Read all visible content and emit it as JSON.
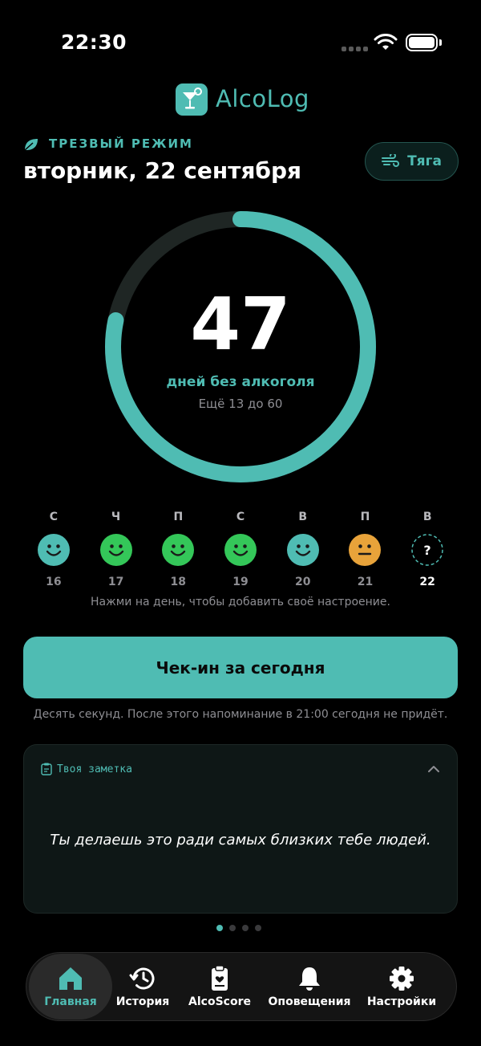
{
  "status": {
    "time": "22:30"
  },
  "app": {
    "name": "AlcoLog"
  },
  "header": {
    "mode_label": "ТРЕЗВЫЙ РЕЖИМ",
    "date": "вторник, 22 сентября",
    "craving_label": "Тяга"
  },
  "counter": {
    "days": "47",
    "days_label": "дней без алкоголя",
    "remaining": "Ещё 13 до 60",
    "progress": 0.783
  },
  "week": [
    {
      "letter": "С",
      "date": "16",
      "mood": "good"
    },
    {
      "letter": "Ч",
      "date": "17",
      "mood": "great"
    },
    {
      "letter": "П",
      "date": "18",
      "mood": "great"
    },
    {
      "letter": "С",
      "date": "19",
      "mood": "great"
    },
    {
      "letter": "В",
      "date": "20",
      "mood": "good"
    },
    {
      "letter": "П",
      "date": "21",
      "mood": "neutral"
    },
    {
      "letter": "В",
      "date": "22",
      "mood": "unknown"
    }
  ],
  "mood_hint": "Нажми на день, чтобы добавить своё настроение.",
  "checkin": {
    "label": "Чек-ин за сегодня",
    "hint": "Десять секунд. После этого напоминание в 21:00 сегодня не придёт."
  },
  "note": {
    "title": "Твоя заметка",
    "text": "Ты делаешь это ради самых близких тебе людей."
  },
  "tabs": [
    {
      "label": "Главная",
      "icon": "home-icon"
    },
    {
      "label": "История",
      "icon": "history-icon"
    },
    {
      "label": "AlcoScore",
      "icon": "clipboard-icon"
    },
    {
      "label": "Оповещения",
      "icon": "bell-icon"
    },
    {
      "label": "Настройки",
      "icon": "gear-icon"
    }
  ],
  "colors": {
    "accent": "#4fbcb3",
    "mood_good": "#4fbcb3",
    "mood_great": "#34c759",
    "mood_neutral": "#e8a33a"
  }
}
